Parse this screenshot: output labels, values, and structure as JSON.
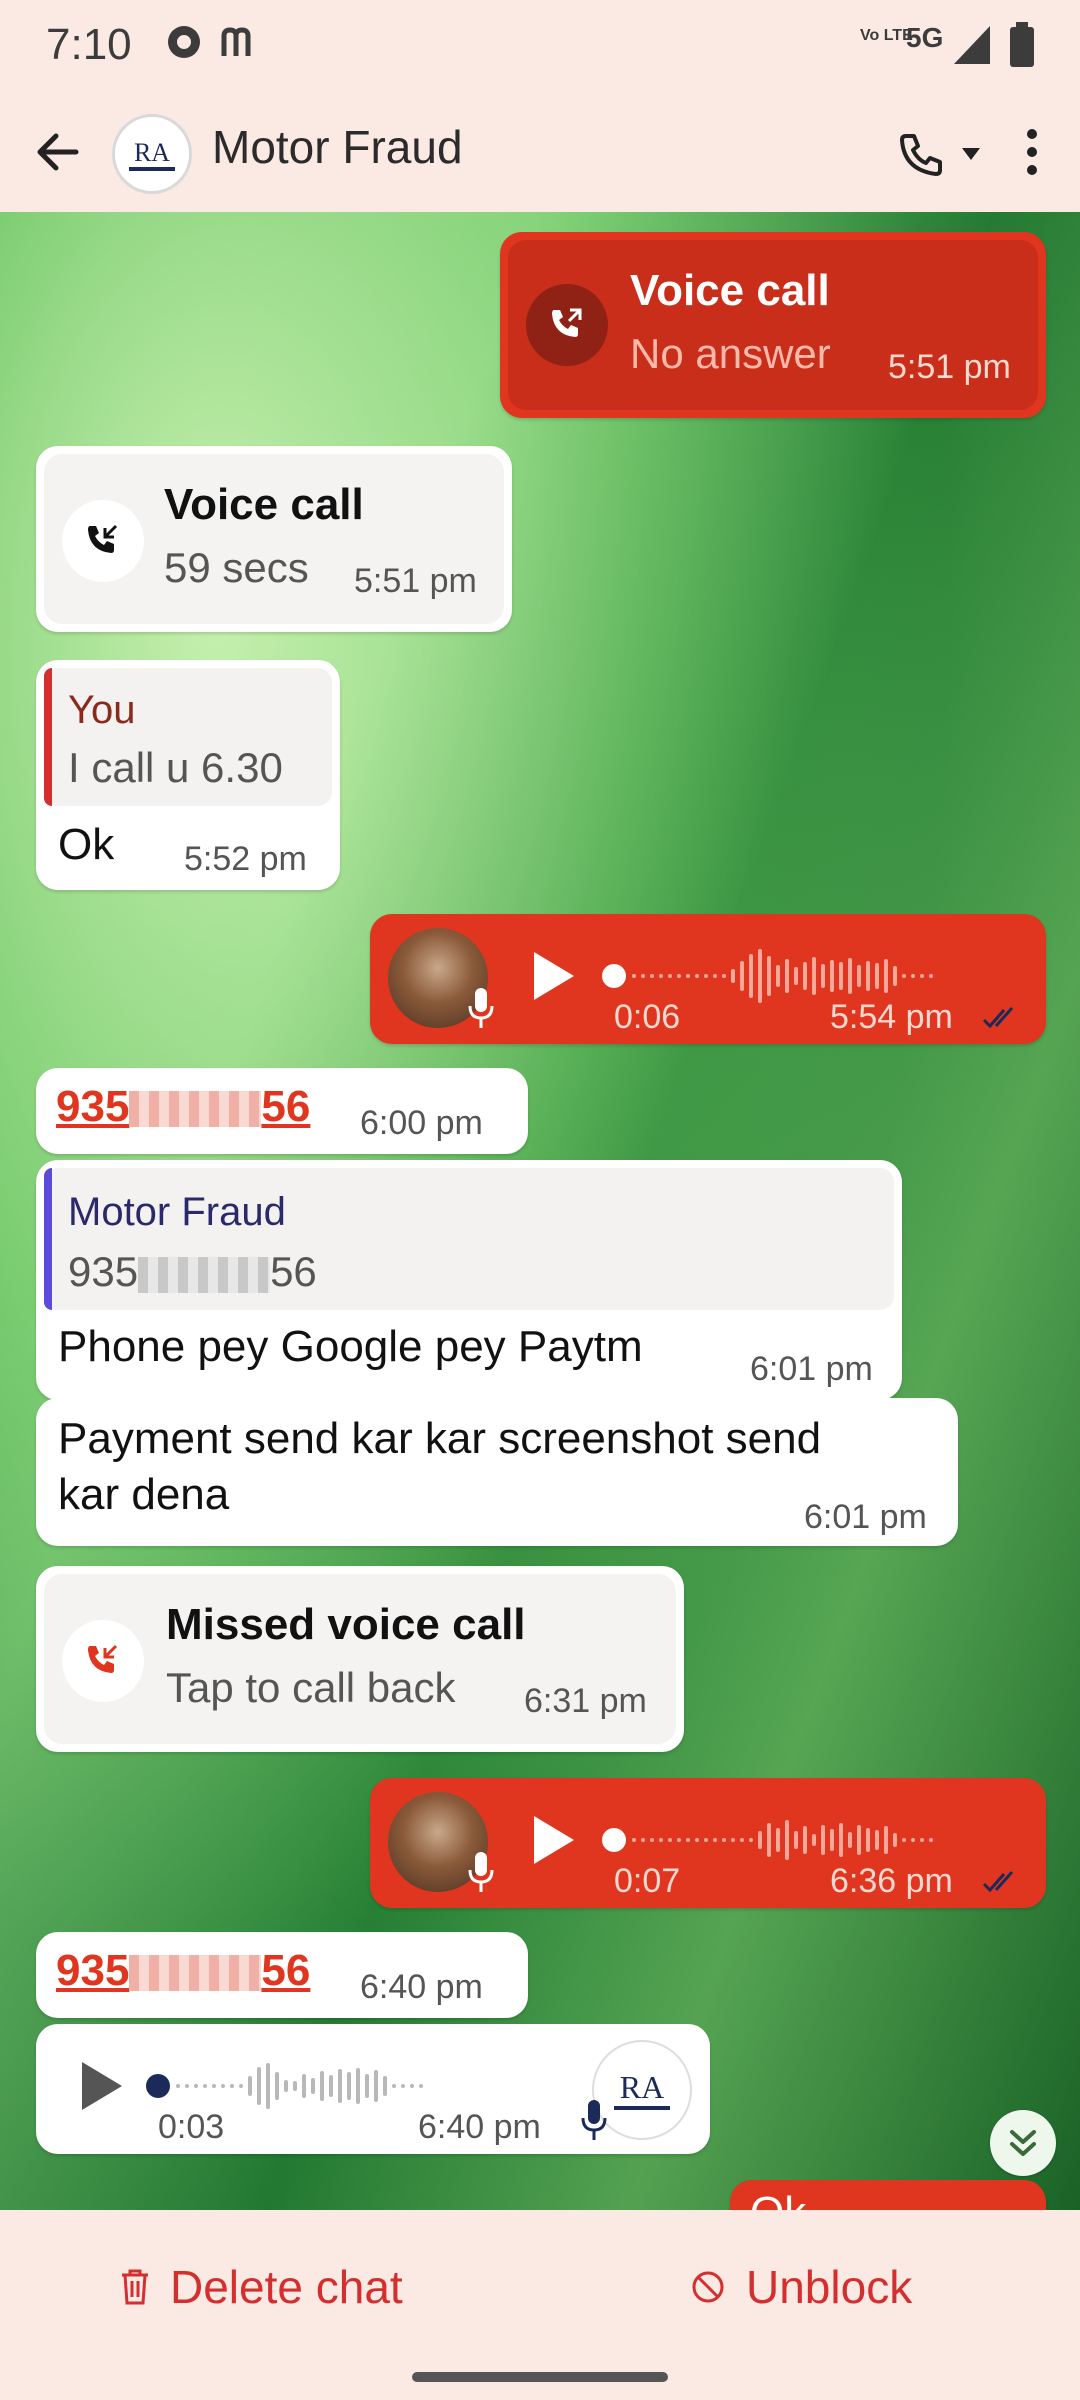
{
  "status_bar": {
    "time": "7:10",
    "network": "5G",
    "volte": "Vo LTE"
  },
  "header": {
    "title": "Motor Fraud",
    "avatar_text": "RA"
  },
  "messages": {
    "m1": {
      "title": "Voice call",
      "subtitle": "No answer",
      "time": "5:51 pm"
    },
    "m2": {
      "title": "Voice call",
      "subtitle": "59 secs",
      "time": "5:51 pm"
    },
    "m3": {
      "quote_name": "You",
      "quote_text": "I call u 6.30",
      "text": "Ok",
      "time": "5:52 pm"
    },
    "m4": {
      "duration": "0:06",
      "time": "5:54 pm"
    },
    "m5": {
      "num_start": "935",
      "num_end": "56",
      "time": "6:00 pm"
    },
    "m6": {
      "quote_name": "Motor Fraud",
      "quote_num_start": "935",
      "quote_num_end": "56",
      "text": "Phone pey Google pey Paytm",
      "time": "6:01 pm"
    },
    "m7": {
      "text_line1": "Payment send kar kar screenshot send",
      "text_line2": "kar dena",
      "time": "6:01 pm"
    },
    "m8": {
      "title": "Missed voice call",
      "subtitle": "Tap to call back",
      "time": "6:31 pm"
    },
    "m9": {
      "duration": "0:07",
      "time": "6:36 pm"
    },
    "m10": {
      "num_start": "935",
      "num_end": "56",
      "time": "6:40 pm"
    },
    "m11": {
      "duration": "0:03",
      "time": "6:40 pm"
    },
    "m12": {
      "text": "Ok"
    }
  },
  "bottom": {
    "delete_label": "Delete chat",
    "unblock_label": "Unblock"
  },
  "colors": {
    "accent": "#e0351e",
    "header_bg": "#fbe9e4",
    "incoming_bg": "#ffffff",
    "danger": "#d32f2f"
  },
  "icons": [
    "back-arrow-icon",
    "phone-icon",
    "dropdown-icon",
    "more-vert-icon",
    "outgoing-call-icon",
    "incoming-call-icon",
    "missed-call-icon",
    "play-icon",
    "mic-icon",
    "double-check-icon",
    "trash-icon",
    "block-icon",
    "scroll-down-icon"
  ]
}
